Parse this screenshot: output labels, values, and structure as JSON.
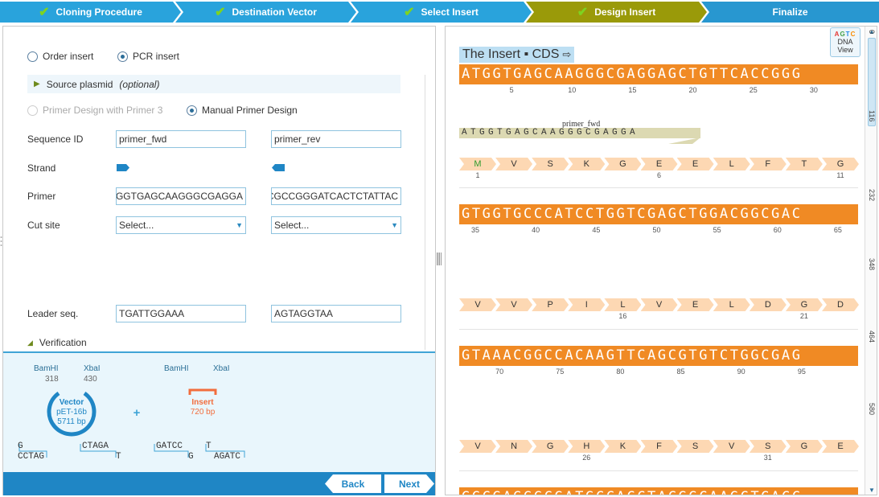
{
  "wizard": {
    "steps": [
      {
        "label": "Cloning Procedure",
        "done": true
      },
      {
        "label": "Destination Vector",
        "done": true
      },
      {
        "label": "Select Insert",
        "done": true
      },
      {
        "label": "Design Insert",
        "done": true
      },
      {
        "label": "Finalize",
        "done": false
      }
    ],
    "check": "✔",
    "colors": {
      "step": "#29a3dc",
      "active": "#9a9a09",
      "finalize": "#2897d0"
    }
  },
  "form": {
    "insert_type": {
      "order": "Order insert",
      "pcr": "PCR insert",
      "selected": "pcr"
    },
    "source_plasmid": {
      "label": "Source plasmid",
      "optional": "(optional)"
    },
    "primer_design": {
      "primer3": "Primer Design with Primer 3",
      "manual": "Manual Primer Design",
      "selected": "manual"
    },
    "labels": {
      "sequence_id": "Sequence ID",
      "strand": "Strand",
      "primer": "Primer",
      "cut_site": "Cut site",
      "leader_seq": "Leader seq.",
      "verification": "Verification"
    },
    "fwd": {
      "sequence_id": "primer_fwd",
      "primer": "TGGTGAGCAAGGGCGAGGA",
      "cut_site": "Select...",
      "leader_seq": "TGATTGGAAA"
    },
    "rev": {
      "sequence_id": "primer_rev",
      "primer": "CGCCGGGATCACTCTATTAC",
      "cut_site": "Select...",
      "leader_seq": "AGTAGGTAA"
    }
  },
  "preview": {
    "vector_sites": [
      {
        "name": "BamHI",
        "pos": "318"
      },
      {
        "name": "XbaI",
        "pos": "430"
      }
    ],
    "insert_sites": [
      "BamHI",
      "XbaI"
    ],
    "vector": {
      "title": "Vector",
      "name": "pET-16b",
      "size": "5711 bp"
    },
    "insert": {
      "title": "Insert",
      "size": "720 bp"
    },
    "plus": "+",
    "vector_ends": {
      "left_top": "G",
      "left_bottom": "CCTAG",
      "right_top": "CTAGA",
      "right_bottom": "T"
    },
    "insert_ends": {
      "left_top": "GATCC",
      "left_bottom": "G",
      "right_top": "T",
      "right_bottom": "AGATC"
    }
  },
  "nav": {
    "back": "Back",
    "next": "Next"
  },
  "viewer": {
    "title": "The Insert ▪ CDS",
    "title_icon": "⇨",
    "dna_view": {
      "letters": [
        "A",
        "G",
        "T",
        "C"
      ],
      "letter_colors": [
        "#e53935",
        "#43a047",
        "#1e88e5",
        "#fb8c00"
      ],
      "line1": "DNA",
      "line2": "View"
    },
    "rows": [
      {
        "seq": "ATGGTGAGCAAGGGCGAGGAGCTGTTCACCGGG",
        "ticks": [
          "5",
          "10",
          "15",
          "20",
          "25",
          "30"
        ],
        "aa": [
          "M",
          "V",
          "S",
          "K",
          "G",
          "E",
          "E",
          "L",
          "F",
          "T",
          "G"
        ],
        "aa_nums": [
          "1",
          "6",
          "11"
        ]
      },
      {
        "seq": "GTGGTGCCCATCCTGGTCGAGCTGGACGGCGAC",
        "ticks": [
          "35",
          "40",
          "45",
          "50",
          "55",
          "60",
          "65"
        ],
        "aa": [
          "V",
          "V",
          "P",
          "I",
          "L",
          "V",
          "E",
          "L",
          "D",
          "G",
          "D"
        ],
        "aa_nums": [
          "16",
          "21"
        ]
      },
      {
        "seq": "GTAAACGGCCACAAGTTCAGCGTGTCTGGCGAG",
        "ticks": [
          "70",
          "75",
          "80",
          "85",
          "90",
          "95"
        ],
        "aa": [
          "V",
          "N",
          "G",
          "H",
          "K",
          "F",
          "S",
          "V",
          "S",
          "G",
          "E"
        ],
        "aa_nums": [
          "26",
          "31"
        ]
      },
      {
        "seq": "GGCGAGGGCGATGCCACCTACGGCAAGCTGACC"
      }
    ],
    "primer": {
      "name": "primer_fwd",
      "seq": "ATGGTGAGCAAGGGCGAGGA"
    },
    "ruler": [
      "0",
      "116",
      "232",
      "348",
      "464",
      "580"
    ]
  }
}
